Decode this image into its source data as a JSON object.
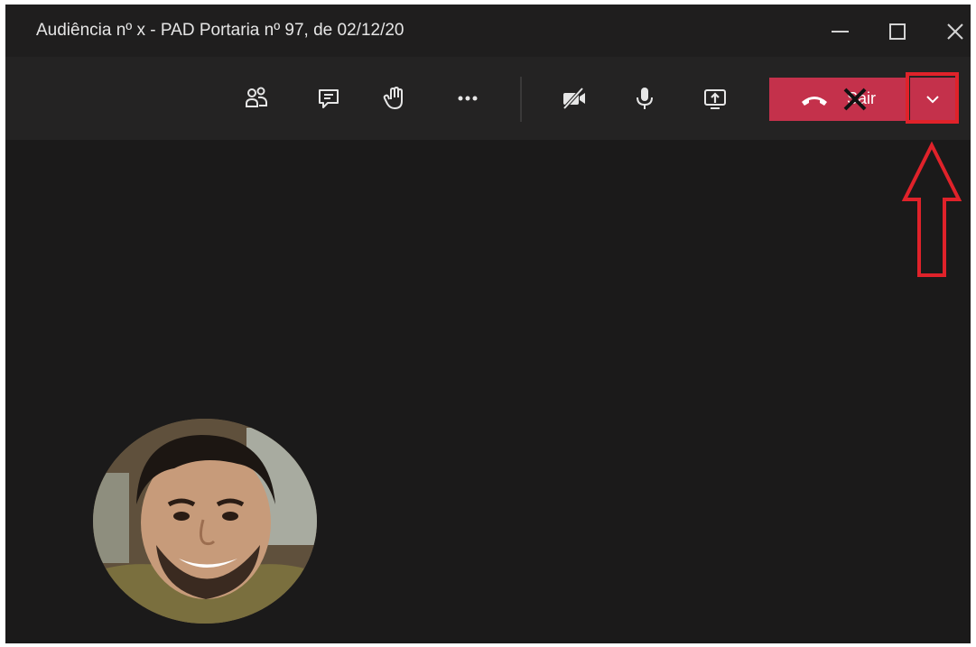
{
  "window": {
    "title": "Audiência nº x - PAD Portaria nº 97, de 02/12/20",
    "controls": [
      "minimize-icon",
      "maximize-icon",
      "close-icon"
    ]
  },
  "toolbar": {
    "items": [
      "participants-icon",
      "chat-icon",
      "raise-hand-icon",
      "more-options-icon",
      "camera-off-icon",
      "microphone-icon",
      "share-screen-icon"
    ],
    "leave_label": "Sair",
    "leave_color": "#c4314b",
    "dropdown_icon": "chevron-down-icon"
  },
  "annotation": {
    "color": "#e0222a"
  },
  "stage": {
    "background": "#1b1a1a"
  }
}
